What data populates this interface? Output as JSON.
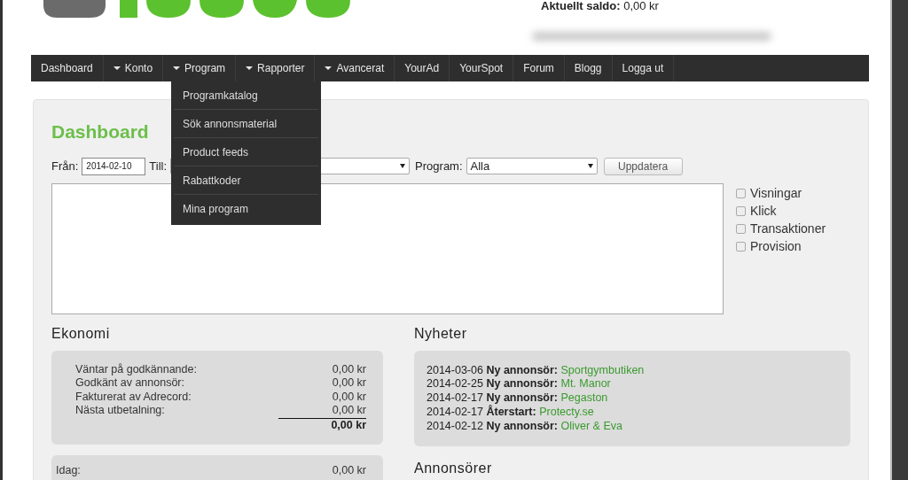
{
  "header": {
    "balance_label": "Aktuellt saldo:",
    "balance_value": "0,00 kr"
  },
  "nav": [
    {
      "label": "Dashboard",
      "kind": "link"
    },
    {
      "label": "Konto",
      "kind": "dropdown"
    },
    {
      "label": "Program",
      "kind": "dropdown"
    },
    {
      "label": "Rapporter",
      "kind": "dropdown"
    },
    {
      "label": "Avancerat",
      "kind": "dropdown"
    },
    {
      "label": "YourAd",
      "kind": "link"
    },
    {
      "label": "YourSpot",
      "kind": "link"
    },
    {
      "label": "Forum",
      "kind": "link"
    },
    {
      "label": "Blogg",
      "kind": "link"
    },
    {
      "label": "Logga ut",
      "kind": "link"
    }
  ],
  "dropdown_menu": [
    "Programkatalog",
    "Sök annonsmaterial",
    "Product feeds",
    "Rabattkoder",
    "Mina program"
  ],
  "dashboard": {
    "title": "Dashboard",
    "from_label": "Från:",
    "from_value": "2014-02-10",
    "till_label": "Till:",
    "program_label": "Program:",
    "program_value": "Alla",
    "button": "Uppdatera",
    "checkboxes": [
      {
        "label": "Visningar",
        "checked": false
      },
      {
        "label": "Klick",
        "checked": false
      },
      {
        "label": "Transaktioner",
        "checked": false
      },
      {
        "label": "Provision",
        "checked": false
      }
    ]
  },
  "ekonomi": {
    "title": "Ekonomi",
    "rows": [
      {
        "label": "Väntar på godkännande:",
        "value": "0,00 kr"
      },
      {
        "label": "Godkänt av annonsör:",
        "value": "0,00 kr"
      },
      {
        "label": "Fakturerat av Adrecord:",
        "value": "0,00 kr"
      },
      {
        "label": "Nästa utbetalning:",
        "value": "0,00 kr"
      }
    ],
    "total": "0,00 kr",
    "period_rows": [
      {
        "label": "Idag:",
        "value": "0,00 kr"
      }
    ]
  },
  "nyheter": {
    "title": "Nyheter",
    "items": [
      {
        "date": "2014-03-06",
        "type": "Ny annonsör:",
        "name": "Sportgymbutiken"
      },
      {
        "date": "2014-02-25",
        "type": "Ny annonsör:",
        "name": "Mt. Manor"
      },
      {
        "date": "2014-02-17",
        "type": "Ny annonsör:",
        "name": "Pegaston"
      },
      {
        "date": "2014-02-17",
        "type": "Återstart:",
        "name": "Protecty.se"
      },
      {
        "date": "2014-02-12",
        "type": "Ny annonsör:",
        "name": "Oliver & Eva"
      }
    ]
  },
  "annonsorer": {
    "title": "Annonsörer"
  }
}
